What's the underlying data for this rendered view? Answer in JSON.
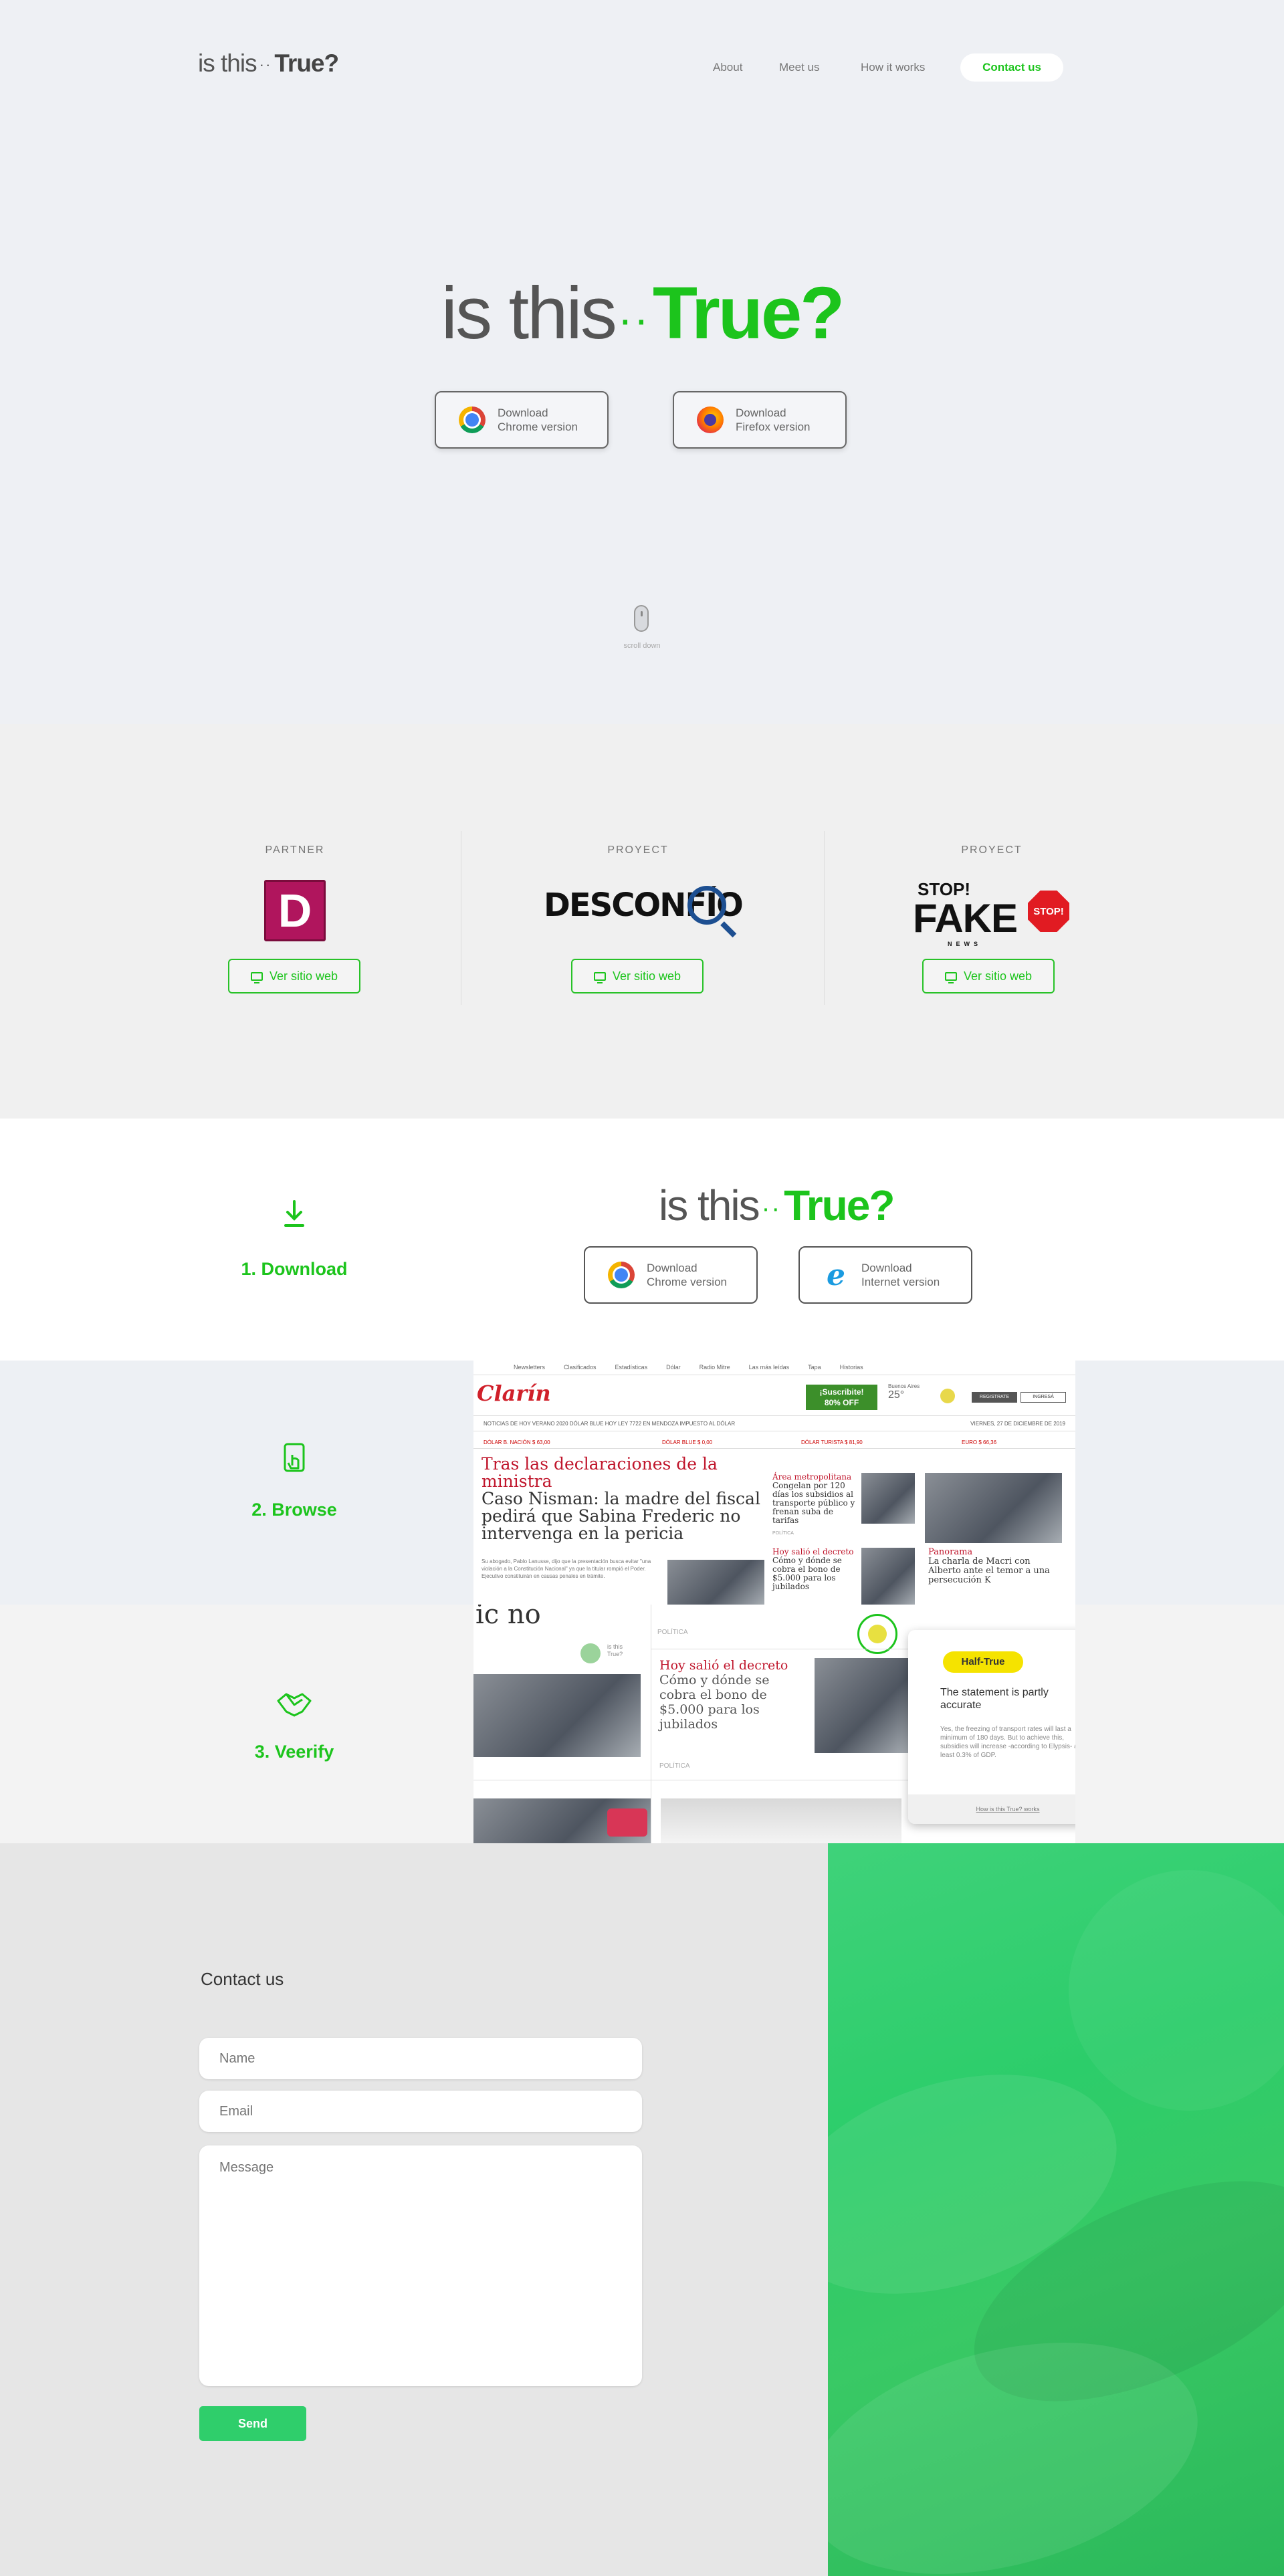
{
  "header": {
    "logo_prefix": "is this",
    "logo_dots": "··",
    "logo_word": "True?",
    "nav": [
      "About",
      "Meet us",
      "How it works"
    ],
    "contact": "Contact us"
  },
  "hero": {
    "logo_prefix": "is this",
    "logo_dots": "··",
    "logo_word": "True?",
    "chrome_line1": "Download",
    "chrome_line2": "Chrome version",
    "firefox_line1": "Download",
    "firefox_line2": "Firefox version",
    "scroll": "scroll down"
  },
  "partners": [
    {
      "label": "PARTNER",
      "logo": "D",
      "button": "Ver sitio web"
    },
    {
      "label": "PROYECT",
      "logo": "DESCONFÍO",
      "button": "Ver sitio web"
    },
    {
      "label": "PROYECT",
      "logo_top": "STOP!",
      "logo_main": "FAKE",
      "logo_sub": "NEWS",
      "stop_sign": "STOP!",
      "button": "Ver sitio web"
    }
  ],
  "steps": {
    "download": {
      "title": "1. Download",
      "logo_prefix": "is this",
      "logo_dots": "··",
      "logo_word": "True?",
      "chrome_line1": "Download",
      "chrome_line2": "Chrome version",
      "ie_line1": "Download",
      "ie_line2": "Internet version"
    },
    "browse": {
      "title": "2. Browse",
      "topbar": [
        "Newsletters",
        "Clasificados",
        "Estadísticas",
        "Dólar",
        "Radio Mitre",
        "Las más leídas",
        "Tapa",
        "Historias"
      ],
      "brand": "Clarín",
      "subscribe_line1": "¡Suscribite!",
      "subscribe_line2": "80% OFF",
      "weather_city": "Buenos Aires",
      "weather_temp": "25°",
      "login": "INGRESÁ",
      "register": "REGISTRATE",
      "nav": "NOTICIAS DE HOY   VERANO 2020   DÓLAR BLUE HOY   LEY 7722 EN MENDOZA   IMPUESTO AL DÓLAR",
      "date": "VIERNES, 27 DE DICIEMBRE DE 2019",
      "dollar": [
        "DÓLAR B. NACIÓN  $ 63,00",
        "DÓLAR BLUE  $ 0,00",
        "DÓLAR TURISTA  $ 81,90",
        "EURO  $ 66,36"
      ],
      "main_red": "Tras las declaraciones de la ministra",
      "main_black": "Caso Nisman: la madre del fiscal pedirá que Sabina Frederic no intervenga en la pericia",
      "lead": "Su abogado, Pablo Lanusse, dijo que la presentación busca evitar \"una violación a la Constitución Nacional\" ya que la titular rompió el Poder. Ejecutivo constituirán en causas penales en trámite.",
      "side1_red": "Área metropolitana",
      "side1": "Congelan por 120 días los subsidios al transporte público y frenan suba de tarifas",
      "side2_red": "Hoy salió el decreto",
      "side2": "Cómo y dónde se cobra el bono de $5.000 para los jubilados",
      "side3_red": "Panorama",
      "side3": "La charla de Macri con Alberto ante el temor a una persecución K",
      "tag": "POLÍTICA"
    },
    "verify": {
      "title": "3. Veerify",
      "fragment": "ic no",
      "tag": "POLÍTICA",
      "headline_red": "Hoy salió el decreto",
      "headline": "Cómo y dónde se cobra el bono de $5.000 para los jubilados",
      "tag2": "POLÍTICA",
      "mini_badge": "is this True?",
      "badge": "Half-True",
      "statement": "The statement is partly accurate",
      "body": "Yes, the freezing of transport rates will last a minimum of 180 days. But to achieve this, subsidies will increase -according to Elypsis- at least 0.3% of GDP.",
      "footer": "How is this True? works"
    }
  },
  "contact": {
    "title": "Contact us",
    "name_placeholder": "Name",
    "email_placeholder": "Email",
    "message_placeholder": "Message",
    "send": "Send"
  },
  "colors": {
    "accent": "#1cc41c",
    "send": "#2fce6b",
    "hero_bg": "#eef0f4",
    "contact_bg": "#e6e6e6"
  }
}
